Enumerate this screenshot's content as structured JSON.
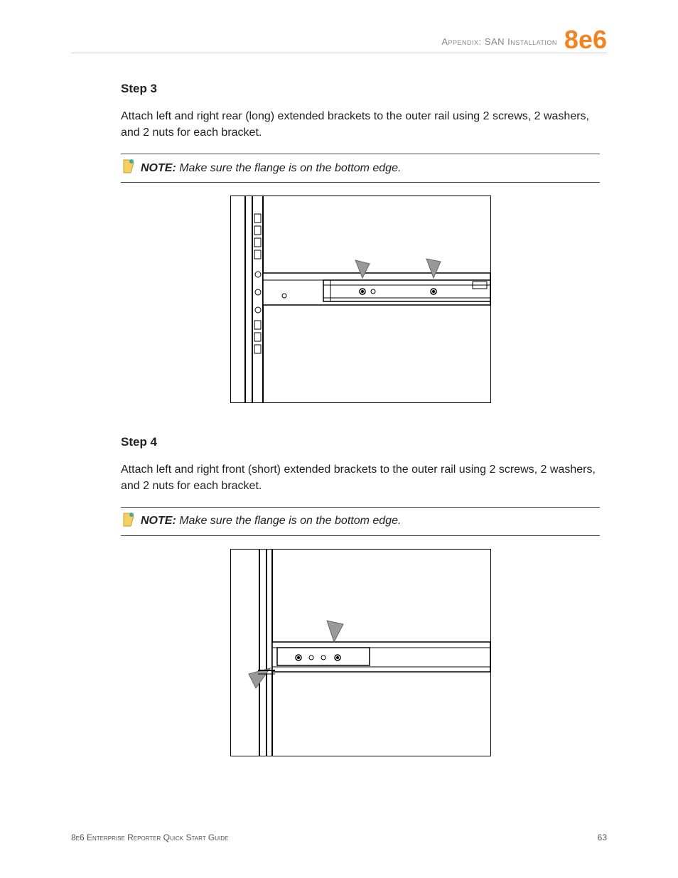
{
  "header": {
    "appendix_text": "Appendix: SAN Installation",
    "logo": "8e6"
  },
  "step3": {
    "title": "Step 3",
    "body": "Attach left and right rear (long) extended brackets to the outer rail using 2 screws, 2 washers, and 2 nuts for each bracket.",
    "note_label": "NOTE:",
    "note_text": " Make sure the flange is on the bottom edge."
  },
  "step4": {
    "title": "Step 4",
    "body": "Attach left and right front (short) extended brackets to the outer rail using 2 screws, 2 washers, and 2 nuts for each bracket.",
    "note_label": "NOTE:",
    "note_text": " Make sure the flange is on the bottom edge."
  },
  "footer": {
    "left": "8e6 Enterprise Reporter Quick Start Guide",
    "right": "63"
  }
}
